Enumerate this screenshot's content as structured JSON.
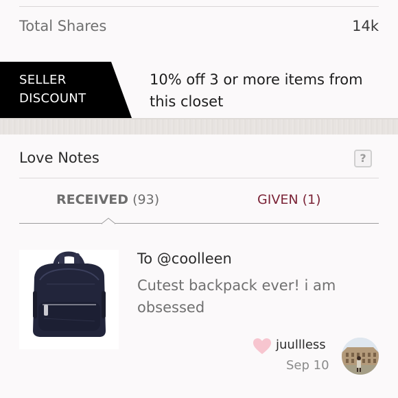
{
  "stats": {
    "label": "Total Shares",
    "value": "14k"
  },
  "discount": {
    "badge_line1": "SELLER",
    "badge_line2": "DISCOUNT",
    "text": "10% off 3 or more items from this closet"
  },
  "love_notes": {
    "title": "Love Notes",
    "help_glyph": "?",
    "tabs": [
      {
        "label": "RECEIVED",
        "count": "(93)",
        "active": true
      },
      {
        "label": "GIVEN",
        "count": "(1)",
        "active": false
      }
    ],
    "note": {
      "to": "To @coolleen",
      "text": "Cutest backpack ever! i am obsessed",
      "username": "juullless",
      "date": "Sep 10",
      "image": "backpack-image",
      "avatar": "user-avatar"
    }
  },
  "colors": {
    "background": "#fbf9fa",
    "badge_black": "#000000",
    "given_tab": "#7b2437",
    "heart": "#f7c5cf"
  }
}
